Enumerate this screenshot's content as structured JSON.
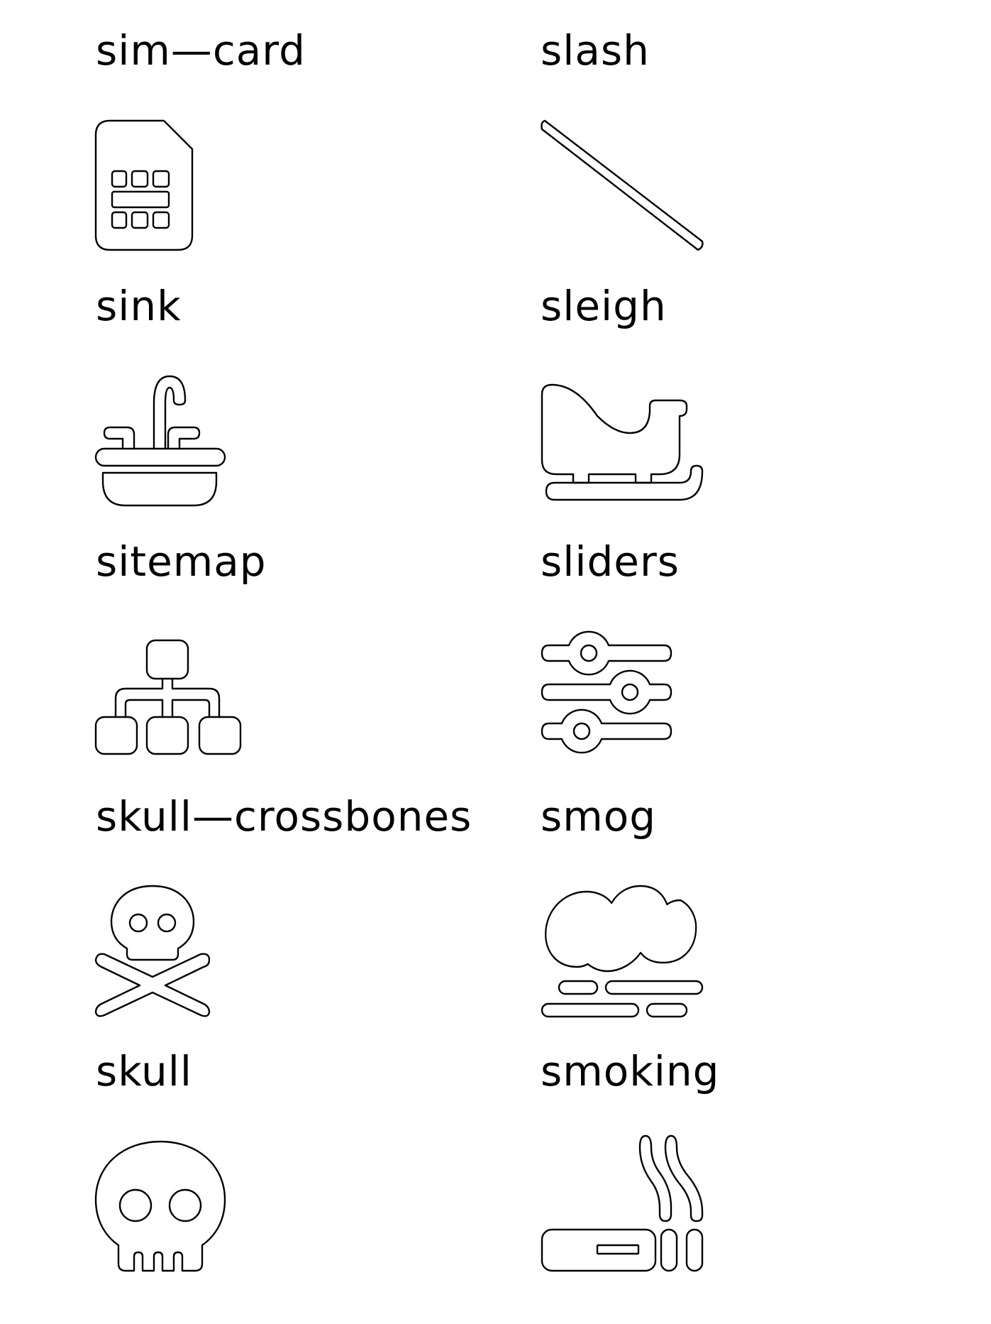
{
  "icons": [
    {
      "label": "sim—card",
      "icon": "sim-card-icon"
    },
    {
      "label": "slash",
      "icon": "slash-icon"
    },
    {
      "label": "sink",
      "icon": "sink-icon"
    },
    {
      "label": "sleigh",
      "icon": "sleigh-icon"
    },
    {
      "label": "sitemap",
      "icon": "sitemap-icon"
    },
    {
      "label": "sliders",
      "icon": "sliders-icon"
    },
    {
      "label": "skull—crossbones",
      "icon": "skull-crossbones-icon"
    },
    {
      "label": "smog",
      "icon": "smog-icon"
    },
    {
      "label": "skull",
      "icon": "skull-icon"
    },
    {
      "label": "smoking",
      "icon": "smoking-icon"
    }
  ]
}
